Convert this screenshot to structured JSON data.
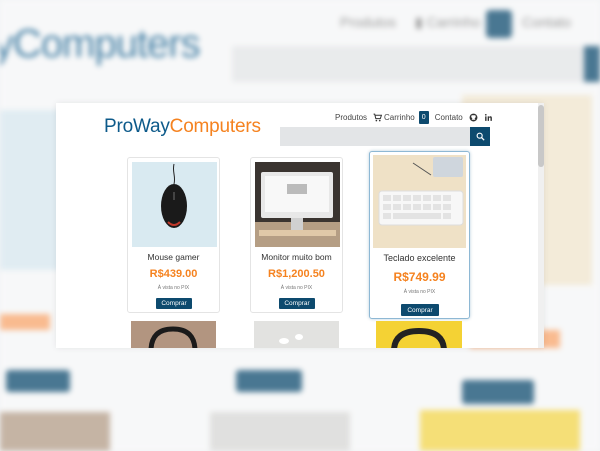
{
  "brand": {
    "part1": "ProWay",
    "part2": "Computers"
  },
  "nav": {
    "products": "Produtos",
    "cart": "Carrinho",
    "cart_count": "0",
    "contact": "Contato"
  },
  "search": {
    "placeholder": ""
  },
  "products": [
    {
      "name": "Mouse gamer",
      "price": "R$439.00",
      "note": "À vista no PIX",
      "buy": "Comprar"
    },
    {
      "name": "Monitor muito bom",
      "price": "R$1,200.50",
      "note": "À vista no PIX",
      "buy": "Comprar"
    },
    {
      "name": "Teclado excelente",
      "price": "R$749.99",
      "note": "À vista no PIX",
      "buy": "Comprar"
    }
  ],
  "colors": {
    "brand_blue": "#0d5a8a",
    "brand_orange": "#f5821f",
    "button": "#0d4a6e"
  },
  "icons": [
    "cart-icon",
    "github-icon",
    "linkedin-icon",
    "search-icon"
  ]
}
